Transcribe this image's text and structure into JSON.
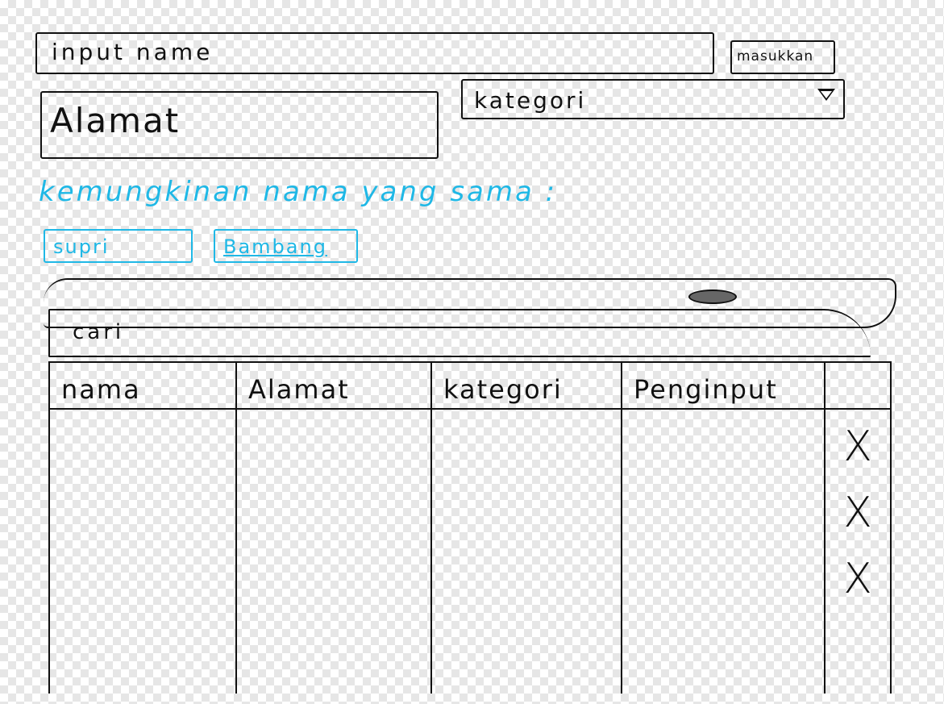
{
  "form": {
    "name_placeholder": "input name",
    "submit_label": "masukkan",
    "address_placeholder": "Alamat",
    "category_placeholder": "kategori"
  },
  "suggestions": {
    "label": "kemungkinan nama yang sama :",
    "items": [
      "supri",
      "Bambang"
    ]
  },
  "search": {
    "placeholder": "cari"
  },
  "table": {
    "columns": [
      "nama",
      "Alamat",
      "kategori",
      "Penginput",
      ""
    ],
    "delete_icons": [
      "X",
      "X",
      "X"
    ]
  },
  "colors": {
    "ink": "#111111",
    "accent": "#1fb8e6"
  }
}
